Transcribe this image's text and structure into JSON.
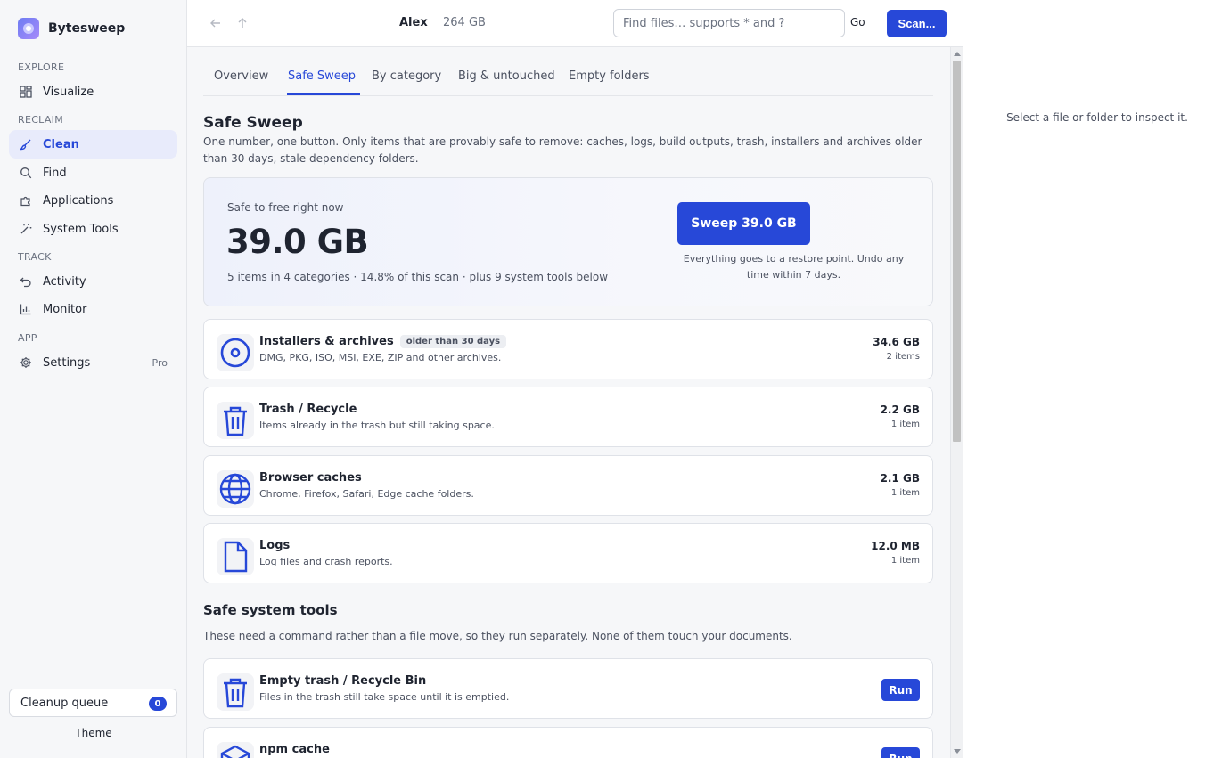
{
  "app": {
    "name": "Bytesweep",
    "accent": "#2748d8"
  },
  "sidebar": {
    "sections": {
      "explore": "EXPLORE",
      "reclaim": "RECLAIM",
      "track": "TRACK",
      "app": "APP"
    },
    "items": [
      {
        "label": "Visualize",
        "icon": "grid-icon"
      },
      {
        "label": "Clean",
        "icon": "brush-icon",
        "active": true
      },
      {
        "label": "Find",
        "icon": "search-icon"
      },
      {
        "label": "Applications",
        "icon": "puzzle-icon"
      },
      {
        "label": "System Tools",
        "icon": "wand-icon"
      },
      {
        "label": "Activity",
        "icon": "undo-icon"
      },
      {
        "label": "Monitor",
        "icon": "bar-chart-icon"
      },
      {
        "label": "Settings",
        "icon": "gear-icon",
        "badge": "Pro"
      }
    ],
    "queue": {
      "label": "Cleanup queue",
      "count": "0"
    },
    "theme_label": "Theme"
  },
  "topbar": {
    "user": "Alex",
    "disk": "264 GB",
    "search_placeholder": "Find files… supports * and ?",
    "go_label": "Go",
    "scan_label": "Scan..."
  },
  "tabs": [
    {
      "label": "Overview"
    },
    {
      "label": "Safe Sweep",
      "active": true
    },
    {
      "label": "By category"
    },
    {
      "label": "Big & untouched"
    },
    {
      "label": "Empty folders"
    }
  ],
  "safe_sweep": {
    "title": "Safe Sweep",
    "description": "One number, one button. Only items that are provably safe to remove: caches, logs, build outputs, trash, installers and archives older than 30 days, stale dependency folders.",
    "hero": {
      "label": "Safe to free right now",
      "amount": "39.0 GB",
      "meta": "5 items in 4 categories · 14.8% of this scan · plus 9 system tools below",
      "button": "Sweep 39.0 GB",
      "note": "Everything goes to a restore point. Undo any time within 7 days."
    },
    "categories": [
      {
        "title": "Installers & archives",
        "tag": "older than 30 days",
        "sub": "DMG, PKG, ISO, MSI, EXE, ZIP and other archives.",
        "size": "34.6 GB",
        "count": "2 items",
        "icon": "disc-icon"
      },
      {
        "title": "Trash / Recycle",
        "sub": "Items already in the trash but still taking space.",
        "size": "2.2 GB",
        "count": "1 item",
        "icon": "trash-icon"
      },
      {
        "title": "Browser caches",
        "sub": "Chrome, Firefox, Safari, Edge cache folders.",
        "size": "2.1 GB",
        "count": "1 item",
        "icon": "globe-icon"
      },
      {
        "title": "Logs",
        "sub": "Log files and crash reports.",
        "size": "12.0 MB",
        "count": "1 item",
        "icon": "file-icon"
      }
    ]
  },
  "system_tools": {
    "title": "Safe system tools",
    "description": "These need a command rather than a file move, so they run separately. None of them touch your documents.",
    "items": [
      {
        "title": "Empty trash / Recycle Bin",
        "sub": "Files in the trash still take space until it is emptied.",
        "button": "Run",
        "icon": "trash-icon"
      },
      {
        "title": "npm cache",
        "sub": "",
        "button": "Run",
        "icon": "package-icon"
      }
    ]
  },
  "inspector": {
    "hint": "Select a file or folder to inspect it."
  }
}
